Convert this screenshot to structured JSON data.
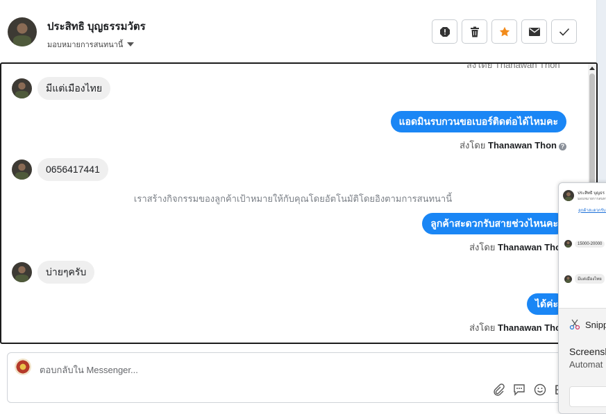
{
  "header": {
    "contact_name": "ประสิทธิ บุญธรรมวัตร",
    "assign_label": "มอบหมายการสนทนานี้",
    "actions": [
      "report-icon",
      "trash-icon",
      "star-icon",
      "envelope-icon",
      "check-icon"
    ],
    "star_color": "#f28b1b"
  },
  "conversation": {
    "cut_off_top": "ส่งโดย Thanawan Thon",
    "messages": {
      "m1": "มีแต่เมืองไทย",
      "m2": "แอดมินรบกวนขอเบอร์ติดต่อได้ไหมคะ",
      "m3": "0656417441",
      "m4": "ลูกค้าสะดวกรับสายช่วงไหนคะ",
      "m5": "บ่ายๆครับ",
      "m6": "ได้ค่ะ"
    },
    "sent_by_prefix": "ส่งโดย",
    "agent_name": "Thanawan Thon",
    "system_note": "เราสร้างกิจกรรมของลูกค้าเป้าหมายให้กับคุณโดยอัตโนมัติโดยอิงตามการสนทนานี้",
    "out_bubble_color": "#1a86f5"
  },
  "composer": {
    "placeholder": "ตอบกลับใน Messenger...",
    "tools": [
      "paperclip-icon",
      "chat-bubble-icon",
      "smiley-icon",
      "baht-icon"
    ]
  },
  "popup": {
    "mini_name": "ประสิทธิ บุญธร",
    "mini_sub": "มอบหมายการสนทนา",
    "mini_link": "ลูกค้าสะดวกรับสาย",
    "mini_m1": "15000-20000",
    "mini_m2": "มีแต่เมืองไทย",
    "snip_title": "Snipp",
    "snip_heading": "Screensh",
    "snip_sub": "Automat"
  }
}
